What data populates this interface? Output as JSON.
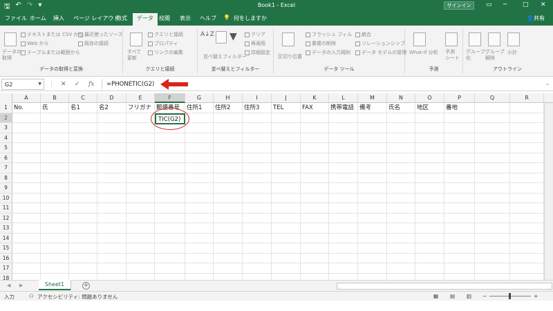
{
  "window": {
    "title": "Book1  -  Excel",
    "signin": "サインイン",
    "minimize": "─",
    "restore": "□",
    "close": "✕",
    "restore_ribbon": "▭"
  },
  "qat": {
    "save": "🖫",
    "undo": "↶",
    "redo": "↷",
    "customize": "▾"
  },
  "tabs": {
    "file": "ファイル",
    "home": "ホーム",
    "insert": "挿入",
    "layout": "ページ レイアウト",
    "formulas": "数式",
    "data": "データ",
    "review": "校閲",
    "view": "表示",
    "help": "ヘルプ",
    "tellme": "何をしますか",
    "share": "共有"
  },
  "ribbon": {
    "get_data": "データの\n取得",
    "from_text_csv": "テキストまたは CSV から",
    "from_web": "Web から",
    "from_table": "テーブルまたは範囲から",
    "recent_sources": "最近使ったソース",
    "existing_connections": "既存の接続",
    "group_get_transform": "データの取得と変換",
    "refresh_all": "すべて\n更新",
    "queries_connections": "クエリと接続",
    "properties": "プロパティ",
    "edit_links": "リンクの編集",
    "group_queries": "クエリと接続",
    "sort": "並べ替え",
    "filter": "フィルター",
    "clear": "クリア",
    "reapply": "再適用",
    "advanced": "詳細設定",
    "group_sort_filter": "並べ替えとフィルター",
    "text_to_columns": "区切り位置",
    "flash_fill": "フラッシュ フィル",
    "remove_duplicates": "重複の削除",
    "data_validation": "データの入力規則",
    "consolidate": "統合",
    "relationships": "リレーションシップ",
    "data_model": "データ モデルの管理",
    "group_data_tools": "データ ツール",
    "whatif": "What-If 分析",
    "forecast_sheet": "予測\nシート",
    "group_forecast": "予測",
    "group_btn": "グループ\n化",
    "ungroup_btn": "グループ\n解除",
    "subtotal": "小計",
    "group_outline": "アウトライン"
  },
  "formula_bar": {
    "name_box": "G2",
    "cancel": "✕",
    "enter": "✓",
    "fx": "fx",
    "formula": "=PHONETIC(G2)"
  },
  "sheet": {
    "columns": [
      "A",
      "B",
      "C",
      "D",
      "E",
      "F",
      "G",
      "H",
      "I",
      "J",
      "K",
      "L",
      "M",
      "N",
      "O",
      "P",
      "Q",
      "R"
    ],
    "rows": [
      "1",
      "2",
      "3",
      "4",
      "5",
      "6",
      "7",
      "8",
      "9",
      "10",
      "11",
      "12",
      "13",
      "14",
      "15",
      "16",
      "17",
      "18"
    ],
    "selected_column": "F",
    "selected_row": "2",
    "row1": [
      "No.",
      "氏",
      "名1",
      "名2",
      "フリガナ",
      "郵便番号",
      "住所1",
      "住所2",
      "住所3",
      "TEL",
      "FAX",
      "携帯電話",
      "備考",
      "氏名",
      "地区",
      "番地"
    ],
    "f2_value": "TIC(G2)"
  },
  "sheet_tabs": {
    "sheet1": "Sheet1",
    "add": "+",
    "prev": "◀",
    "next": "▶"
  },
  "status": {
    "mode": "入力",
    "accessibility": "アクセシビリティ: 問題ありません",
    "zoom_minus": "−",
    "zoom_plus": "+"
  },
  "colors": {
    "accent": "#217346",
    "annotation": "#d9241c"
  }
}
